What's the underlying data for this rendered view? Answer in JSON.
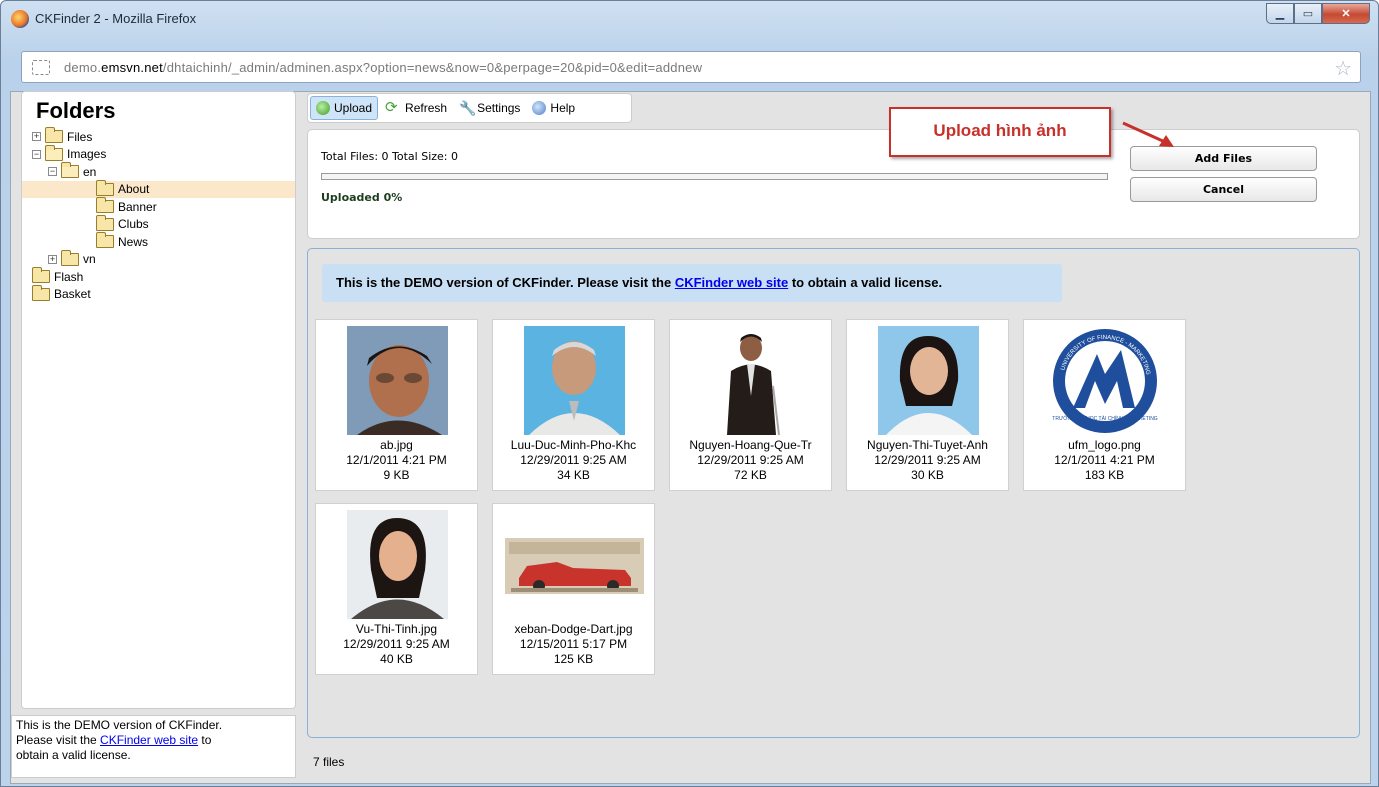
{
  "window": {
    "title": "CKFinder 2 - Mozilla Firefox",
    "controls": [
      "minimize",
      "maximize",
      "close"
    ]
  },
  "addressbar": {
    "url_prefix": "demo.",
    "url_domain": "emsvn.net",
    "url_path": "/dhtaichinh/_admin/adminen.aspx?option=news&now=0&perpage=20&pid=0&edit=addnew"
  },
  "folders": {
    "title": "Folders",
    "tree": [
      {
        "label": "Files",
        "expander": "+"
      },
      {
        "label": "Images",
        "expander": "−"
      },
      {
        "label": "en",
        "expander": "−"
      },
      {
        "label": "About",
        "expander": ""
      },
      {
        "label": "Banner",
        "expander": ""
      },
      {
        "label": "Clubs",
        "expander": ""
      },
      {
        "label": "News",
        "expander": ""
      },
      {
        "label": "vn",
        "expander": "+"
      },
      {
        "label": "Flash",
        "expander": ""
      },
      {
        "label": "Basket",
        "expander": ""
      }
    ],
    "selected": "About"
  },
  "demo_note": {
    "line1": "This is the DEMO version of CKFinder.",
    "line2_pre": "Please visit the ",
    "link": "CKFinder web site",
    "line2_post": " to",
    "line3": "obtain a valid license."
  },
  "toolbar": {
    "upload": "Upload",
    "refresh": "Refresh",
    "settings": "Settings",
    "help": "Help"
  },
  "upload_panel": {
    "stats": "Total Files:  0  Total Size:  0",
    "progress_fraction": 0,
    "uploaded": "Uploaded 0%",
    "add_files": "Add Files",
    "cancel": "Cancel"
  },
  "callout": {
    "text": "Upload hình ảnh",
    "color": "#c8312a"
  },
  "files_banner": {
    "pre": "This is the DEMO version of CKFinder. Please visit the ",
    "link": "CKFinder web site",
    "post": " to obtain a valid license."
  },
  "files": [
    {
      "name": "ab.jpg",
      "date": "12/1/2011 4:21 PM",
      "size": "9 KB"
    },
    {
      "name": "Luu-Duc-Minh-Pho-Khc",
      "date": "12/29/2011 9:25 AM",
      "size": "34 KB"
    },
    {
      "name": "Nguyen-Hoang-Que-Tr",
      "date": "12/29/2011 9:25 AM",
      "size": "72 KB"
    },
    {
      "name": "Nguyen-Thi-Tuyet-Anh",
      "date": "12/29/2011 9:25 AM",
      "size": "30 KB"
    },
    {
      "name": "ufm_logo.png",
      "date": "12/1/2011 4:21 PM",
      "size": "183 KB"
    },
    {
      "name": "Vu-Thi-Tinh.jpg",
      "date": "12/29/2011 9:25 AM",
      "size": "40 KB"
    },
    {
      "name": "xeban-Dodge-Dart.jpg",
      "date": "12/15/2011 5:17 PM",
      "size": "125 KB"
    }
  ],
  "logo": {
    "ring_text": "UNIVERSITY OF FINANCE - MARKETING",
    "sub_text": "TRƯỜNG ĐẠI HỌC TÀI CHÍNH - MARKETING"
  },
  "status": {
    "count": "7 files"
  }
}
